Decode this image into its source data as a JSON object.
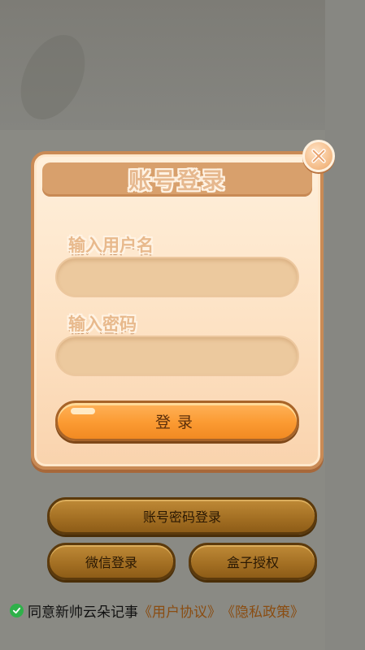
{
  "dialog": {
    "title": "账号登录",
    "username_label": "输入用户名",
    "username_value": "",
    "password_label": "输入密码",
    "password_value": "",
    "submit_label": "登录"
  },
  "buttons": {
    "account_login": "账号密码登录",
    "wechat_login": "微信登录",
    "box_auth": "盒子授权"
  },
  "agreement": {
    "checked": true,
    "text": "同意新帅云朵记事",
    "user_agreement": "《用户协议》",
    "privacy_policy": "《隐私政策》"
  },
  "colors": {
    "accent": "#fb9a32",
    "check": "#2fb14a",
    "link": "#8a4d12"
  },
  "icons": {
    "close": "close-icon",
    "check": "check-icon"
  }
}
